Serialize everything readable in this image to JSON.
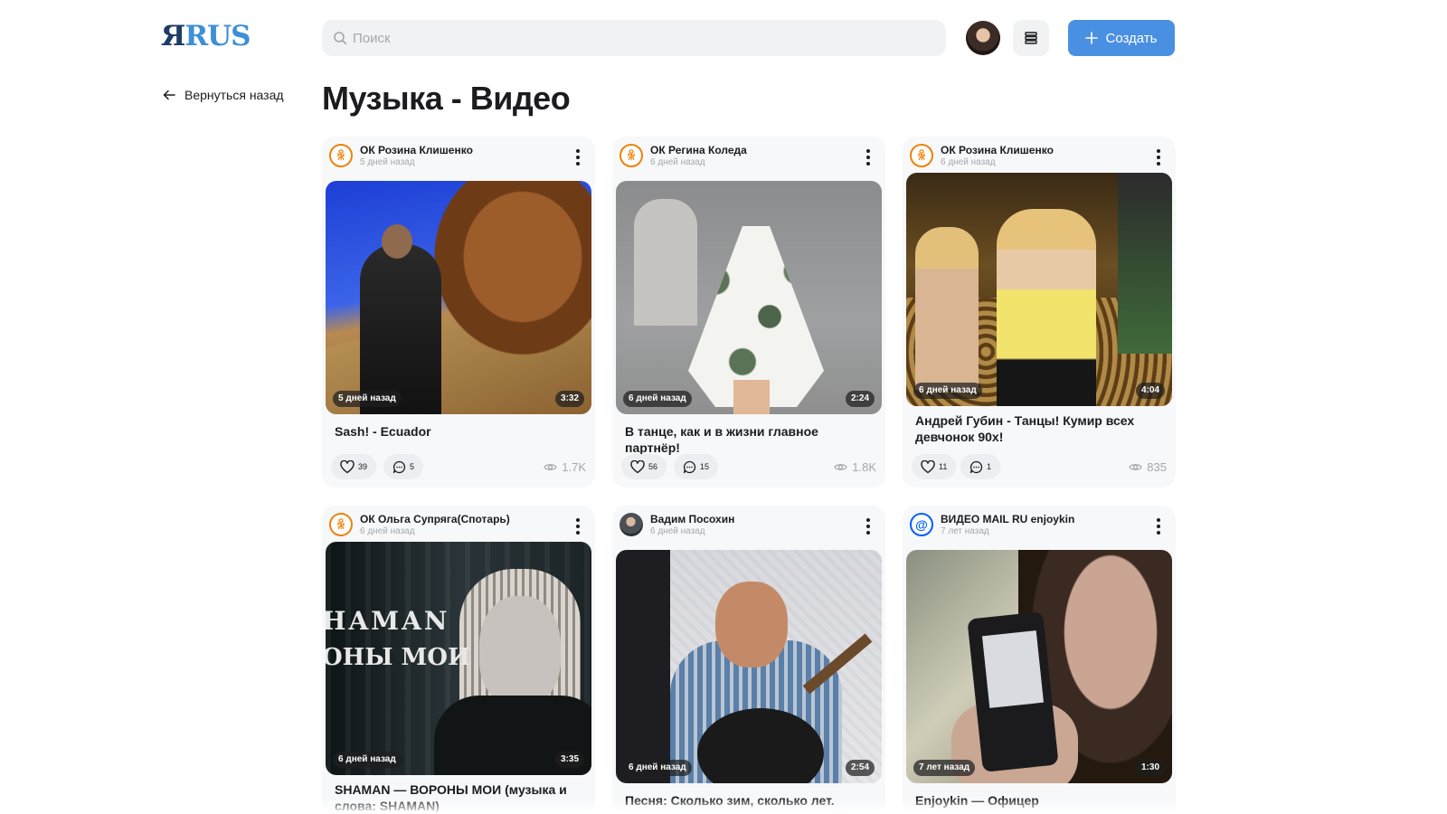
{
  "header": {
    "logo_ya": "Я",
    "logo_rus": "RUS",
    "search_placeholder": "Поиск",
    "create_label": "Создать",
    "accent_color": "#4a90e2"
  },
  "nav": {
    "back_label": "Вернуться назад"
  },
  "page": {
    "title": "Музыка - Видео"
  },
  "cards": [
    {
      "channel": "ОК Розина Клишенко",
      "channel_icon": "ok-icon",
      "posted": "5 дней назад",
      "badge_time": "5 дней назад",
      "duration": "3:32",
      "title": "Sash! - Ecuador",
      "likes": "39",
      "comments": "5",
      "views": "1.7K"
    },
    {
      "channel": "ОК Регина Коледа",
      "channel_icon": "ok-icon",
      "posted": "6 дней назад",
      "badge_time": "6 дней назад",
      "duration": "2:24",
      "title": "В танце, как и в жизни главное партнёр!",
      "likes": "56",
      "comments": "15",
      "views": "1.8K"
    },
    {
      "channel": "ОК Розина Клишенко",
      "channel_icon": "ok-icon",
      "posted": "6 дней назад",
      "badge_time": "6 дней назад",
      "duration": "4:04",
      "title": "Андрей Губин - Танцы! Кумир всех девчонок 90х!",
      "likes": "11",
      "comments": "1",
      "views": "835"
    },
    {
      "channel": "ОК Ольга Супряга(Спотарь)",
      "channel_icon": "ok-icon",
      "posted": "6 дней назад",
      "badge_time": "6 дней назад",
      "duration": "3:35",
      "title": "SHAMAN — ВОРОНЫ МОИ (музыка и слова: SHAMAN)",
      "thumb_text_1": "HAMAN",
      "thumb_text_2": "ОНЫ МОИ"
    },
    {
      "channel": "Вадим Посохин",
      "channel_icon": "user-avatar",
      "posted": "6 дней назад",
      "badge_time": "6 дней назад",
      "duration": "2:54",
      "title": "Песня: Сколько зим, сколько лет."
    },
    {
      "channel": "ВИДЕО MAIL RU enjoykin",
      "channel_icon": "mail-at-icon",
      "posted": "7 лет назад",
      "badge_time": "7 лет назад",
      "duration": "1:30",
      "title": "Enjoykin — Офицер"
    }
  ]
}
